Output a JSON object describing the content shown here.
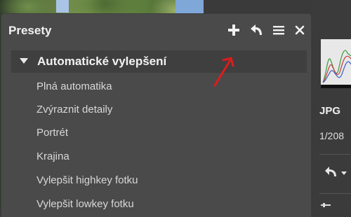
{
  "panel": {
    "title": "Presety",
    "toolbar": {
      "add_icon": "plus-icon",
      "reset_icon": "undo-arrow-icon",
      "menu_icon": "hamburger-menu-icon",
      "close_icon": "close-icon"
    },
    "section": {
      "label": "Automatické vylepšení",
      "expanded": true
    },
    "items": [
      {
        "label": "Plná automatika"
      },
      {
        "label": "Zvýraznit detaily"
      },
      {
        "label": "Portrét"
      },
      {
        "label": "Krajina"
      },
      {
        "label": "Vylepšit highkey fotku"
      },
      {
        "label": "Vylepšit lowkey fotku"
      }
    ]
  },
  "info": {
    "format": "JPG",
    "exposure": "1/208"
  },
  "colors": {
    "panel_bg": "#4a4a4a",
    "section_bg": "#3f3f3f",
    "annotation_arrow": "#e01b1b"
  }
}
